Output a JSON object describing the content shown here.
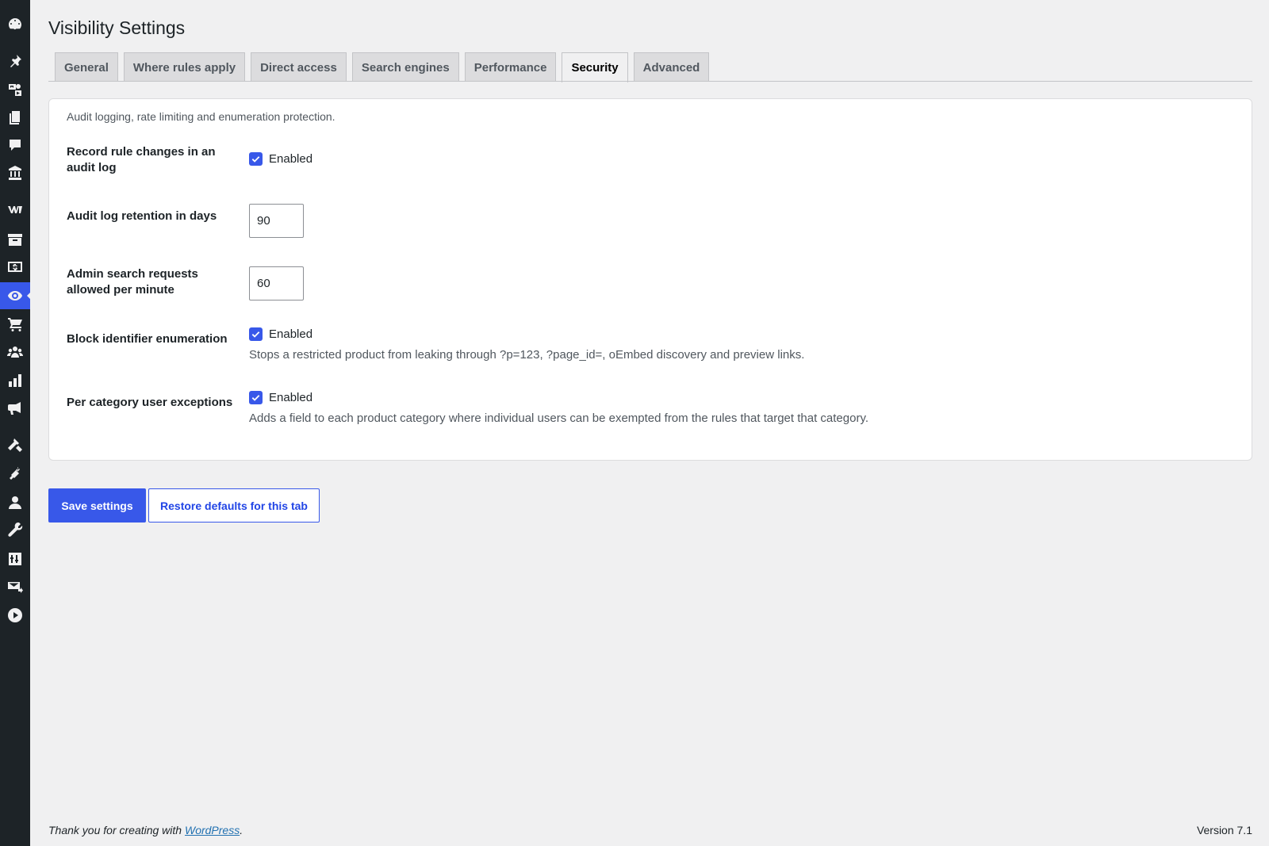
{
  "sidebar": {
    "icons": [
      {
        "name": "dashboard-icon"
      },
      {
        "name": "pin-icon"
      },
      {
        "name": "media-icon"
      },
      {
        "name": "pages-icon"
      },
      {
        "name": "comments-icon"
      },
      {
        "name": "bank-icon"
      },
      {
        "name": "woocommerce-icon"
      },
      {
        "name": "archive-icon"
      },
      {
        "name": "money-icon"
      },
      {
        "name": "eye-icon",
        "active": true
      },
      {
        "name": "cart-icon"
      },
      {
        "name": "groups-icon"
      },
      {
        "name": "chart-icon"
      },
      {
        "name": "megaphone-icon"
      },
      {
        "name": "hammer-icon"
      },
      {
        "name": "plugin-icon"
      },
      {
        "name": "user-icon"
      },
      {
        "name": "wrench-icon"
      },
      {
        "name": "settings-icon"
      },
      {
        "name": "mail-icon"
      },
      {
        "name": "play-icon"
      }
    ],
    "accent_color": "#3858e9"
  },
  "page": {
    "title": "Visibility Settings"
  },
  "tabs": [
    {
      "label": "General"
    },
    {
      "label": "Where rules apply"
    },
    {
      "label": "Direct access"
    },
    {
      "label": "Search engines"
    },
    {
      "label": "Performance"
    },
    {
      "label": "Security",
      "active": true
    },
    {
      "label": "Advanced"
    }
  ],
  "section": {
    "intro": "Audit logging, rate limiting and enumeration protection.",
    "audit_log": {
      "label": "Record rule changes in an audit log",
      "checkbox_label": "Enabled",
      "checked": true
    },
    "retention": {
      "label": "Audit log retention in days",
      "value": "90"
    },
    "rate_limit": {
      "label": "Admin search requests allowed per minute",
      "value": "60"
    },
    "enumeration": {
      "label": "Block identifier enumeration",
      "checkbox_label": "Enabled",
      "checked": true,
      "help": "Stops a restricted product from leaking through ?p=123, ?page_id=, oEmbed discovery and preview links."
    },
    "category_exceptions": {
      "label": "Per category user exceptions",
      "checkbox_label": "Enabled",
      "checked": true,
      "help": "Adds a field to each product category where individual users can be exempted from the rules that target that category."
    }
  },
  "actions": {
    "save_label": "Save settings",
    "restore_label": "Restore defaults for this tab"
  },
  "footer": {
    "thanks_prefix": "Thank you for creating with ",
    "link_text": "WordPress",
    "thanks_suffix": ".",
    "version": "Version 7.1"
  }
}
